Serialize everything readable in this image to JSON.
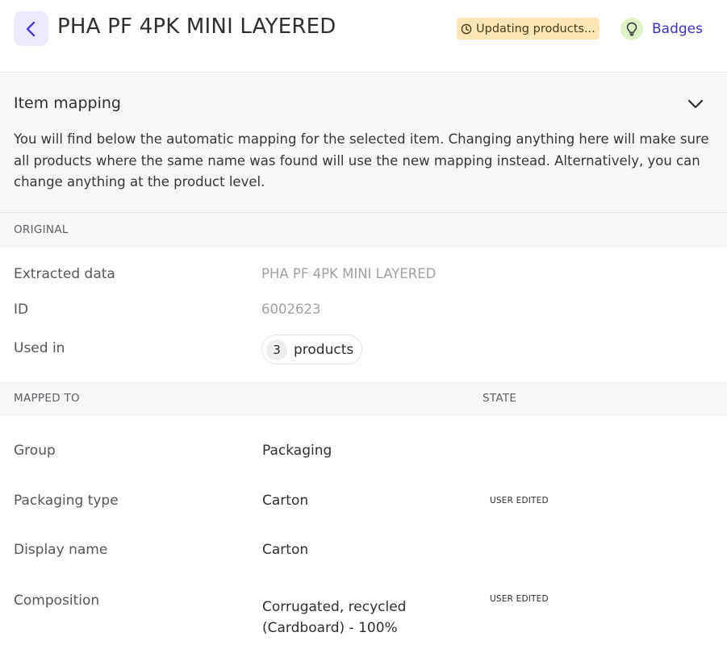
{
  "header": {
    "title": "PHA PF 4PK MINI LAYERED",
    "status_text": "Updating products...",
    "badges_label": "Badges"
  },
  "mapping": {
    "title": "Item mapping",
    "description": "You will find below the automatic mapping for the selected item. Changing anything here will make sure all products where the same name was found will use the new mapping instead. Alternatively, you can change anything at the product level."
  },
  "original": {
    "header": "ORIGINAL",
    "rows": [
      {
        "label": "Extracted data",
        "value": "PHA PF 4PK MINI LAYERED"
      },
      {
        "label": "ID",
        "value": "6002623"
      }
    ],
    "used_in": {
      "label": "Used in",
      "count": "3",
      "unit": "products"
    }
  },
  "mapped": {
    "header": "MAPPED TO",
    "state_header": "STATE",
    "rows": [
      {
        "label": "Group",
        "value": "Packaging",
        "state": ""
      },
      {
        "label": "Packaging type",
        "value": "Carton",
        "state": "USER EDITED"
      },
      {
        "label": "Display name",
        "value": "Carton",
        "state": ""
      },
      {
        "label": "Composition",
        "value": "Corrugated, recycled (Cardboard) - 100%",
        "state": "USER EDITED"
      }
    ]
  },
  "icons": {
    "back": "chevron-left-icon",
    "status": "clock-icon",
    "badges": "lightbulb-icon",
    "collapse": "chevron-down-icon"
  },
  "colors": {
    "accent": "#3b2fbf",
    "back_bg": "#ebe9fb",
    "status_bg": "#fbe6b4",
    "bulb_bg": "#dff3c9",
    "section_bg": "#f7f7f7"
  }
}
